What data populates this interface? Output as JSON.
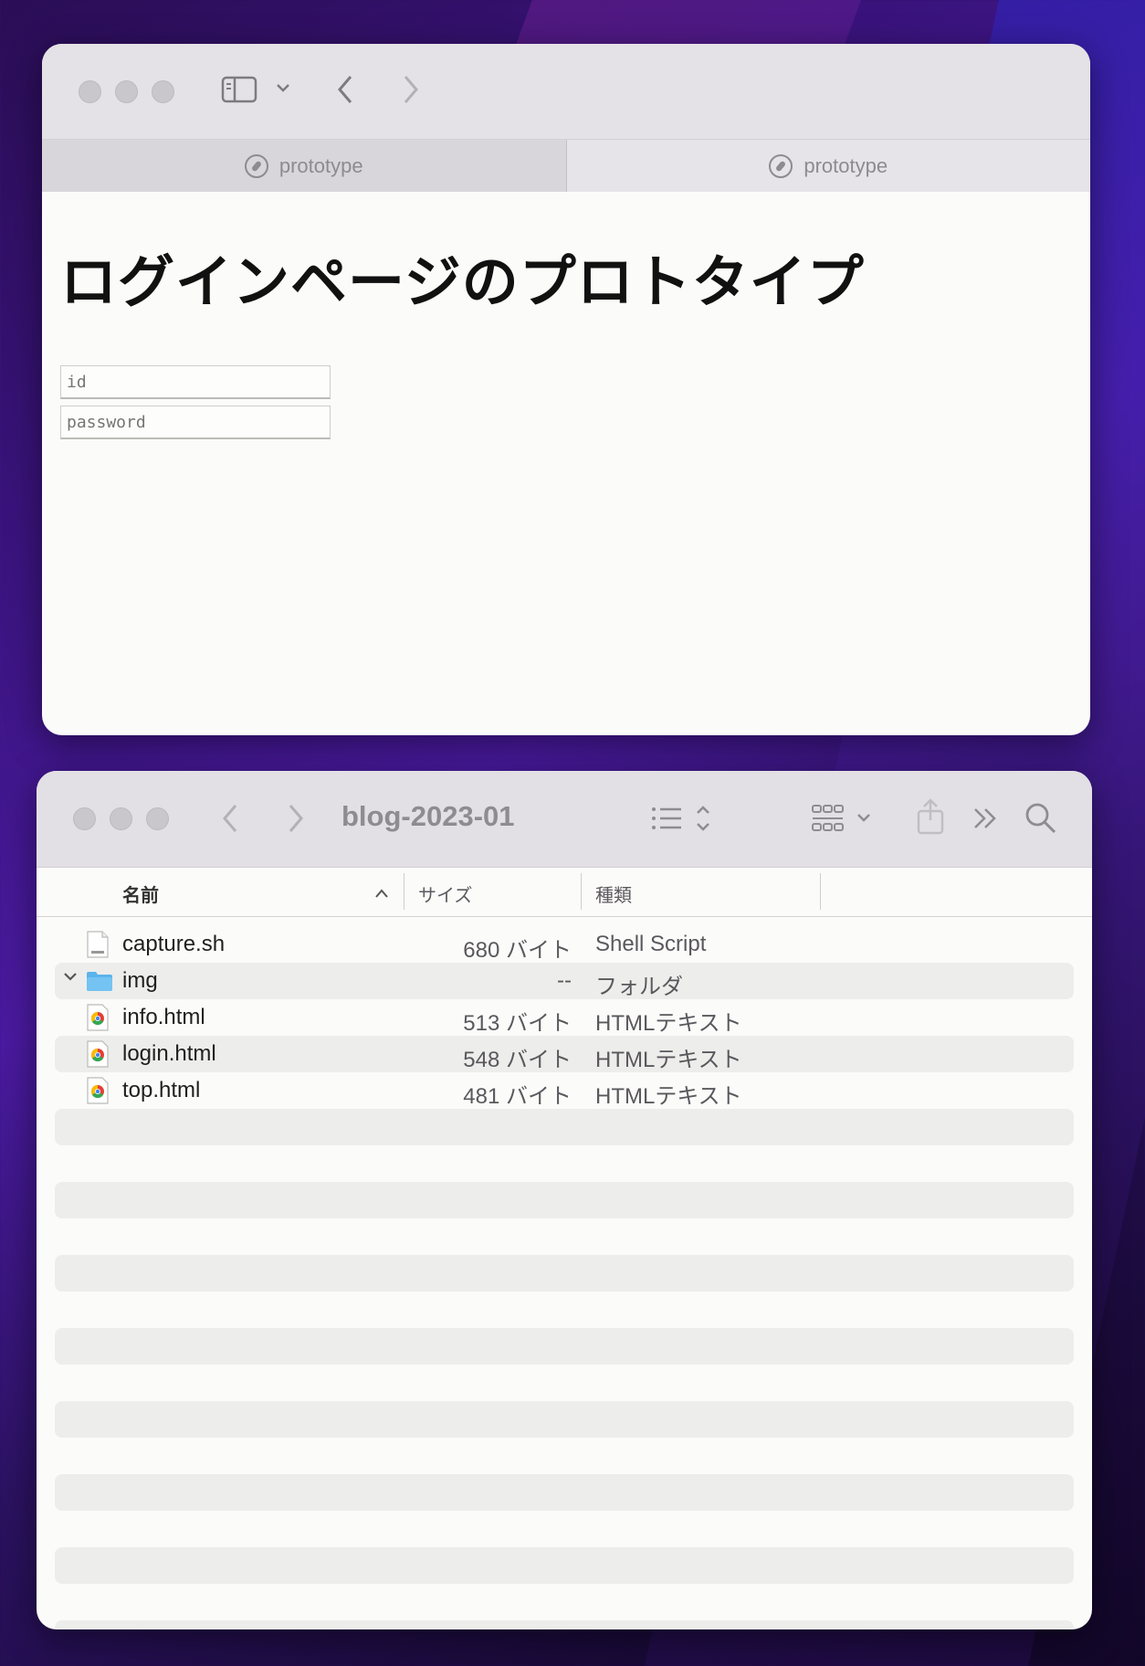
{
  "browser": {
    "tabs": [
      {
        "label": "prototype",
        "active": true
      },
      {
        "label": "prototype",
        "active": false
      }
    ],
    "page": {
      "heading": "ログインページのプロトタイプ",
      "id_placeholder": "id",
      "password_placeholder": "password"
    },
    "toolbar": {
      "sidebar_icon": "sidebar-icon",
      "back_icon": "chevron-left-icon",
      "forward_icon": "chevron-right-icon"
    }
  },
  "finder": {
    "title": "blog-2023-01",
    "columns": {
      "name": "名前",
      "size": "サイズ",
      "kind": "種類"
    },
    "files": [
      {
        "name": "capture.sh",
        "size": "680 バイト",
        "kind": "Shell Script",
        "icon": "shell-script-icon"
      },
      {
        "name": "img",
        "size": "--",
        "kind": "フォルダ",
        "icon": "folder-icon"
      },
      {
        "name": "info.html",
        "size": "513 バイト",
        "kind": "HTMLテキスト",
        "icon": "chrome-doc-icon"
      },
      {
        "name": "login.html",
        "size": "548 バイト",
        "kind": "HTMLテキスト",
        "icon": "chrome-doc-icon"
      },
      {
        "name": "top.html",
        "size": "481 バイト",
        "kind": "HTMLテキスト",
        "icon": "chrome-doc-icon"
      }
    ],
    "colors": {
      "folder": "#5ab4ec",
      "window_bg": "#fbfbf9",
      "toolbar_bg": "#e2e0e4"
    }
  }
}
